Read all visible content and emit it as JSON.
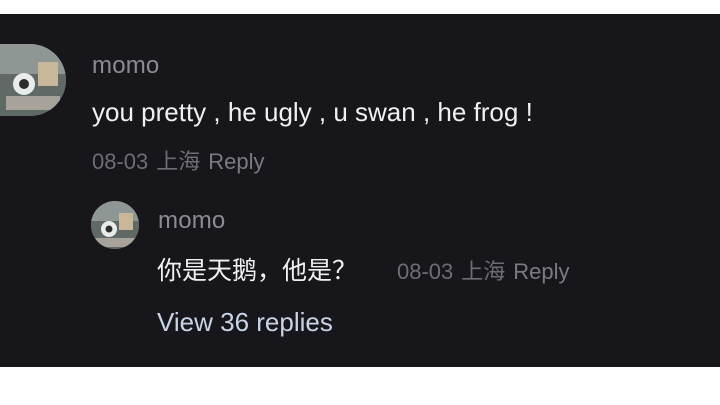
{
  "comments": [
    {
      "username": "momo",
      "text": "you pretty , he ugly , u swan , he frog !",
      "date": "08-03",
      "location": "上海",
      "reply_label": "Reply"
    }
  ],
  "reply": {
    "username": "momo",
    "text": "你是天鹅，他是？",
    "date": "08-03",
    "location": "上海",
    "reply_label": "Reply"
  },
  "view_replies_label": "View 36 replies",
  "colors": {
    "background": "#17171b",
    "username": "#8b8b91",
    "text": "#f0f0f2",
    "meta": "#6d6d73",
    "link": "#c9d3e6"
  },
  "icons": {
    "avatar": "user-avatar-photo"
  }
}
